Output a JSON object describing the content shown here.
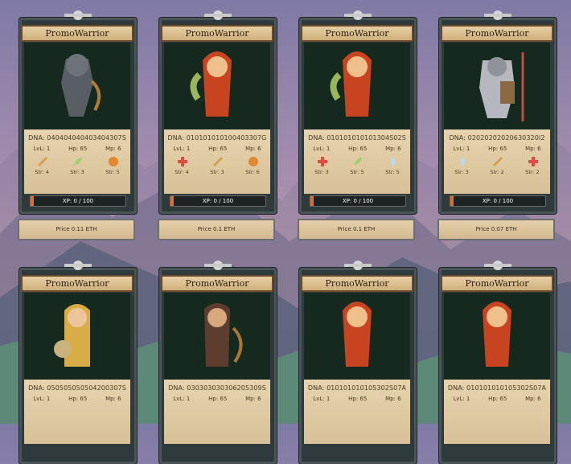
{
  "game_title": "PromoWarrior",
  "cards": [
    {
      "name": "PromoWarrior",
      "dna": "DNA: 040404040403404307S",
      "lvl": "LvL: 1",
      "hp": "Hp: 65",
      "mp": "Mp: 6",
      "skills": [
        "Str: 4",
        "Str: 3",
        "Str: 5"
      ],
      "xp": "XP: 0 / 100",
      "price": "Price 0.11 ETH",
      "icon": "knight-armor-icon"
    },
    {
      "name": "PromoWarrior",
      "dna": "DNA: 010101010100403307G",
      "lvl": "LvL: 1",
      "hp": "Hp: 65",
      "mp": "Mp: 6",
      "skills": [
        "Str: 4",
        "Str: 3",
        "Str: 6"
      ],
      "xp": "XP: 0 / 100",
      "price": "Price 0.1 ETH",
      "icon": "fire-mage-icon"
    },
    {
      "name": "PromoWarrior",
      "dna": "DNA: 010101010101304S02S",
      "lvl": "LvL: 1",
      "hp": "Hp: 65",
      "mp": "Mp: 6",
      "skills": [
        "Str: 3",
        "Str: 5",
        "Str: 5"
      ],
      "xp": "XP: 0 / 100",
      "price": "Price 0.1 ETH",
      "icon": "fire-mage-icon"
    },
    {
      "name": "PromoWarrior",
      "dna": "DNA: 02020202020630320I2",
      "lvl": "LvL: 1",
      "hp": "Hp: 65",
      "mp": "Mp: 6",
      "skills": [
        "Str: 3",
        "Str: 2",
        "Str: 2"
      ],
      "xp": "XP: 0 / 100",
      "price": "Price 0.07 ETH",
      "icon": "armored-knight-icon"
    },
    {
      "name": "PromoWarrior",
      "dna": "DNA: 050505050504200307S",
      "lvl": "LvL: 1",
      "hp": "Hp: 65",
      "mp": "Mp: 6",
      "skills": [
        "",
        "",
        ""
      ],
      "xp": "",
      "price": "",
      "icon": "paladin-icon"
    },
    {
      "name": "PromoWarrior",
      "dna": "DNA: 030303030306205309S",
      "lvl": "LvL: 1",
      "hp": "Hp: 65",
      "mp": "Mp: 6",
      "skills": [
        "",
        "",
        ""
      ],
      "xp": "",
      "price": "",
      "icon": "ranger-icon"
    },
    {
      "name": "PromoWarrior",
      "dna": "DNA: 010101010105302S07A",
      "lvl": "LvL: 1",
      "hp": "Hp: 65",
      "mp": "Mp: 6",
      "skills": [
        "",
        "",
        ""
      ],
      "xp": "",
      "price": "",
      "icon": "fire-mage-icon"
    },
    {
      "name": "PromoWarrior",
      "dna": "DNA: 010101010105302S07A",
      "lvl": "LvL: 1",
      "hp": "Hp: 65",
      "mp": "Mp: 6",
      "skills": [
        "",
        "",
        ""
      ],
      "xp": "",
      "price": "",
      "icon": "fire-mage-icon"
    }
  ]
}
